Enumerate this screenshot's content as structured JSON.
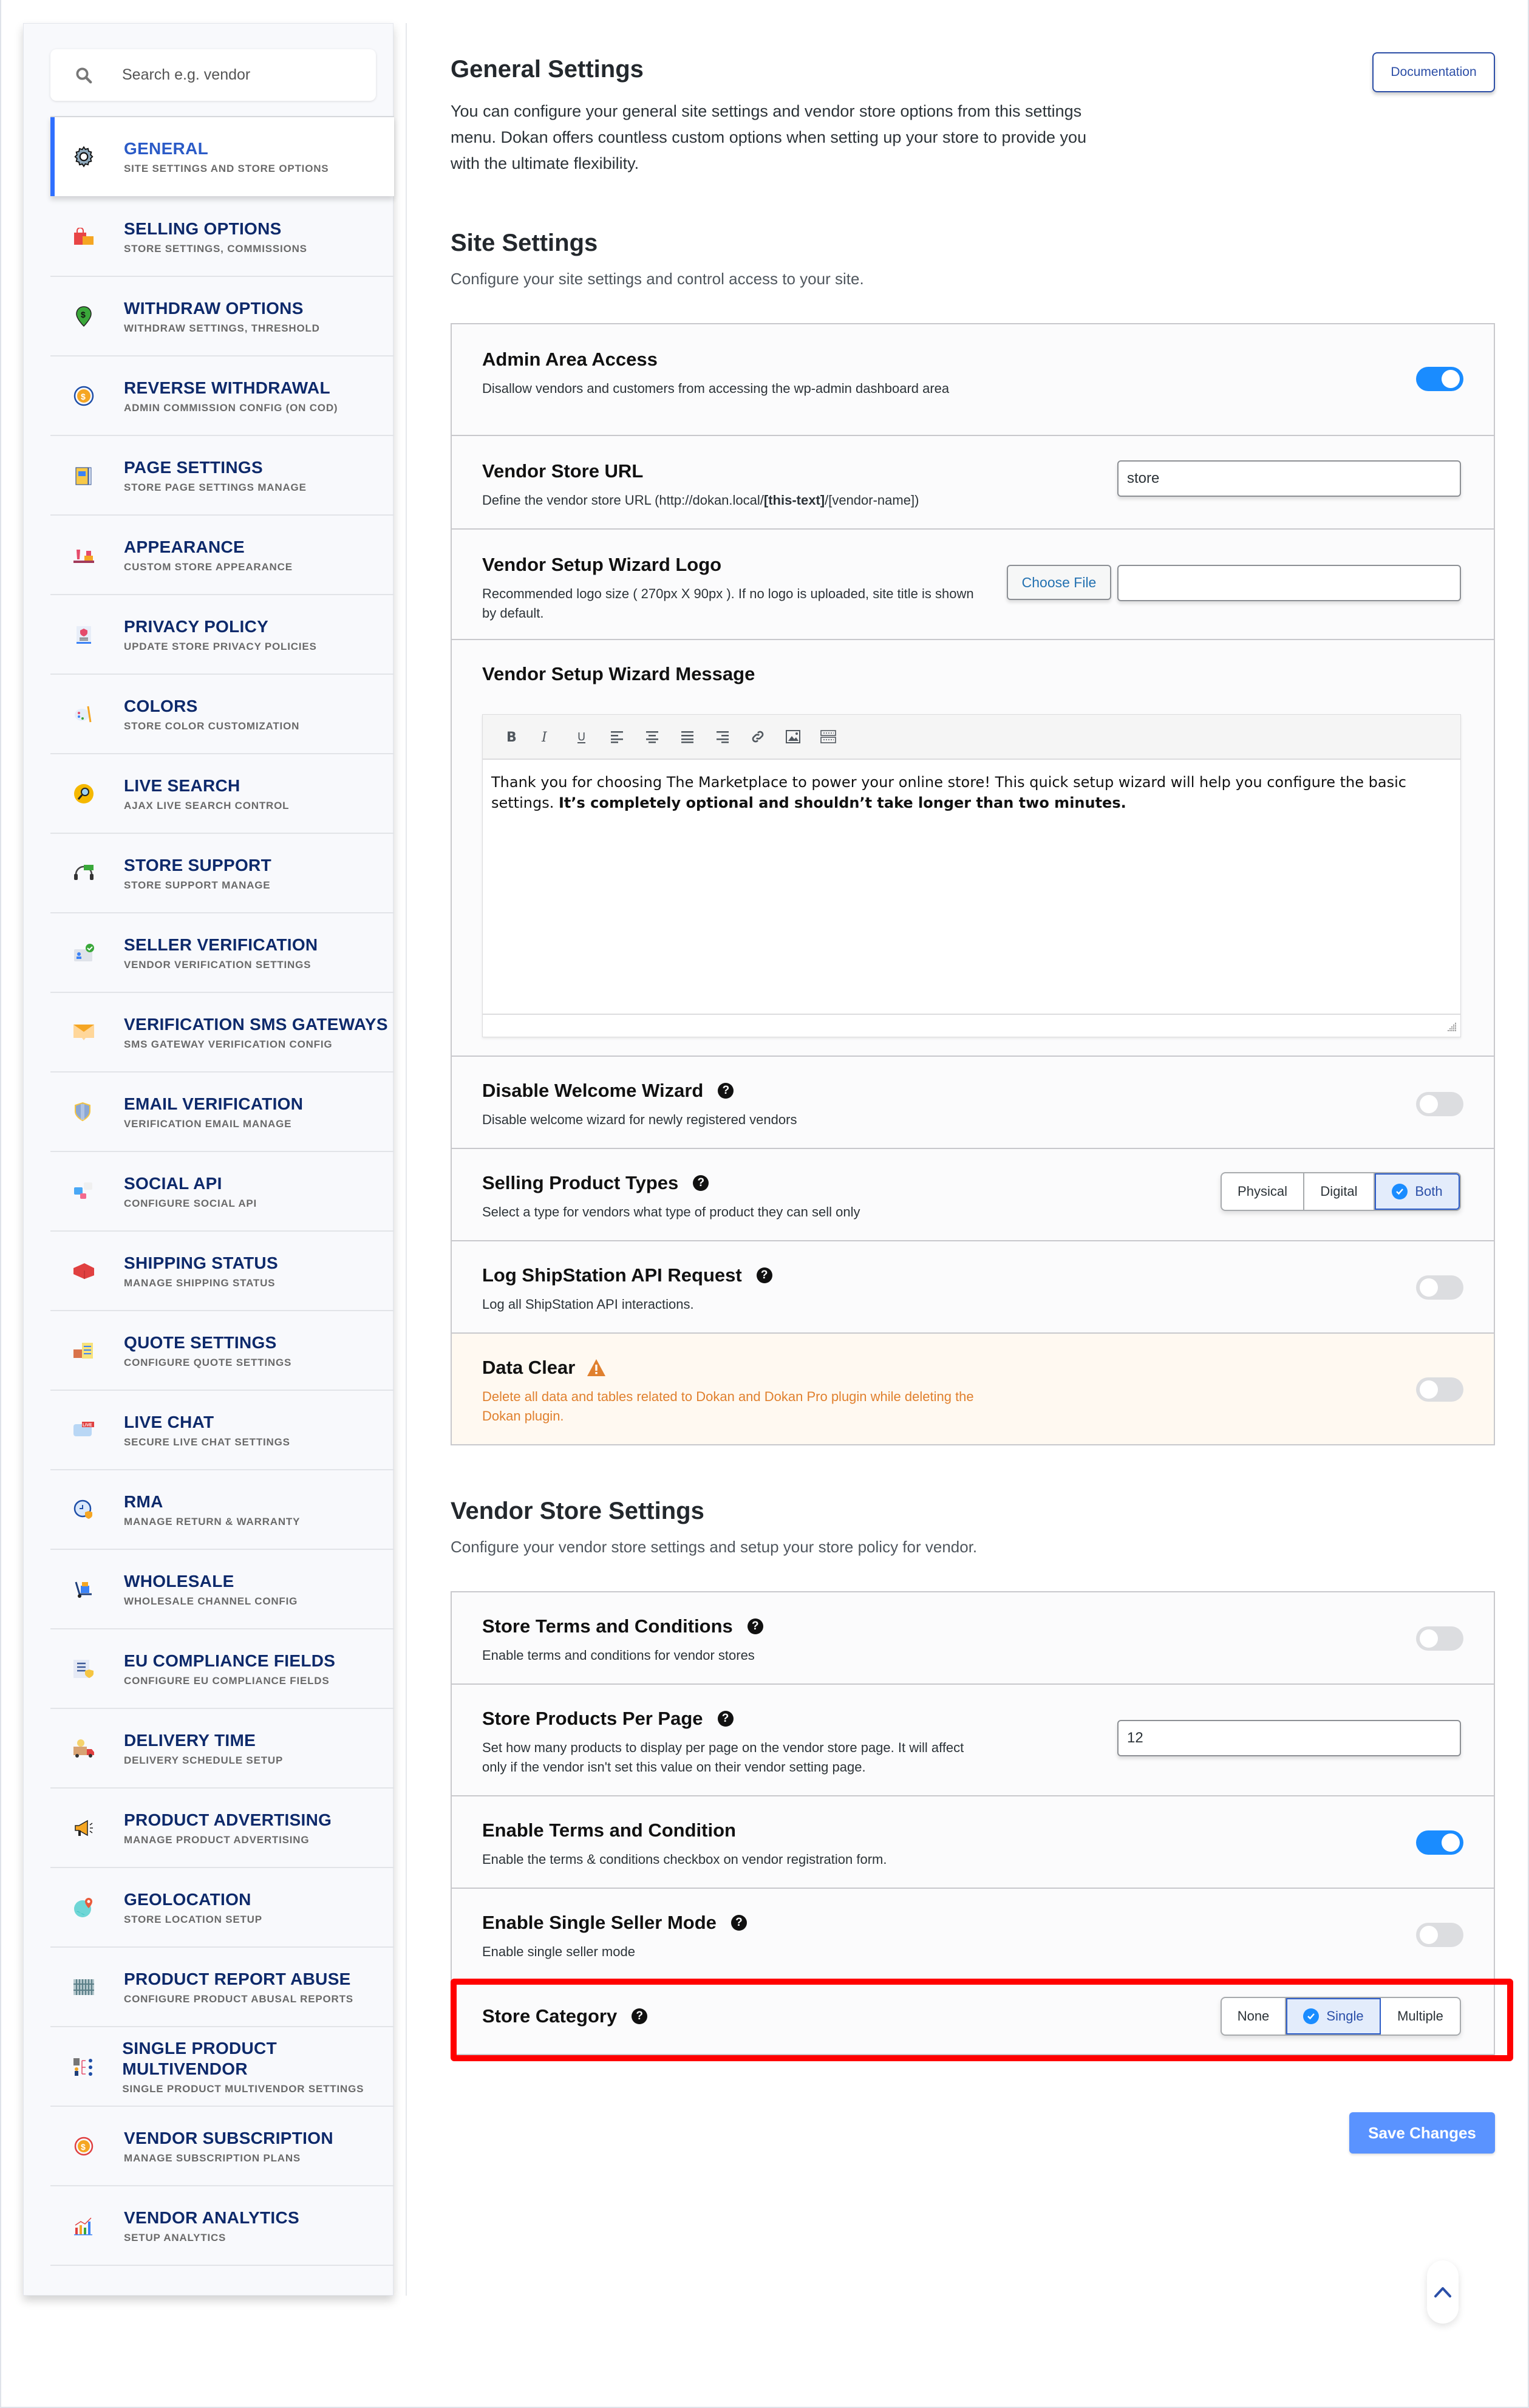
{
  "search": {
    "placeholder": "Search e.g. vendor"
  },
  "sidebar": {
    "items": [
      {
        "title": "GENERAL",
        "subtitle": "SITE SETTINGS AND STORE OPTIONS",
        "icon": "gear-icon",
        "active": true
      },
      {
        "title": "SELLING OPTIONS",
        "subtitle": "STORE SETTINGS, COMMISSIONS",
        "icon": "shopping-bag-icon"
      },
      {
        "title": "WITHDRAW OPTIONS",
        "subtitle": "WITHDRAW SETTINGS, THRESHOLD",
        "icon": "money-pin-icon"
      },
      {
        "title": "REVERSE WITHDRAWAL",
        "subtitle": "ADMIN COMMISSION CONFIG (ON COD)",
        "icon": "coin-cycle-icon"
      },
      {
        "title": "PAGE SETTINGS",
        "subtitle": "STORE PAGE SETTINGS MANAGE",
        "icon": "page-icon"
      },
      {
        "title": "APPEARANCE",
        "subtitle": "CUSTOM STORE APPEARANCE",
        "icon": "store-display-icon"
      },
      {
        "title": "PRIVACY POLICY",
        "subtitle": "UPDATE STORE PRIVACY POLICIES",
        "icon": "privacy-document-icon"
      },
      {
        "title": "COLORS",
        "subtitle": "STORE COLOR CUSTOMIZATION",
        "icon": "palette-icon"
      },
      {
        "title": "LIVE SEARCH",
        "subtitle": "AJAX LIVE SEARCH CONTROL",
        "icon": "magnifier-icon"
      },
      {
        "title": "STORE SUPPORT",
        "subtitle": "STORE SUPPORT MANAGE",
        "icon": "headset-icon"
      },
      {
        "title": "SELLER VERIFICATION",
        "subtitle": "VENDOR VERIFICATION SETTINGS",
        "icon": "id-card-check-icon"
      },
      {
        "title": "VERIFICATION SMS GATEWAYS",
        "subtitle": "SMS GATEWAY VERIFICATION CONFIG",
        "icon": "envelope-icon"
      },
      {
        "title": "EMAIL VERIFICATION",
        "subtitle": "VERIFICATION EMAIL MANAGE",
        "icon": "shield-check-icon"
      },
      {
        "title": "SOCIAL API",
        "subtitle": "CONFIGURE SOCIAL API",
        "icon": "social-bubbles-icon"
      },
      {
        "title": "SHIPPING STATUS",
        "subtitle": "MANAGE SHIPPING STATUS",
        "icon": "container-icon"
      },
      {
        "title": "QUOTE SETTINGS",
        "subtitle": "CONFIGURE QUOTE SETTINGS",
        "icon": "quote-checklist-icon"
      },
      {
        "title": "LIVE CHAT",
        "subtitle": "SECURE LIVE CHAT SETTINGS",
        "icon": "live-chat-icon"
      },
      {
        "title": "RMA",
        "subtitle": "MANAGE RETURN & WARRANTY",
        "icon": "warranty-clock-icon"
      },
      {
        "title": "WHOLESALE",
        "subtitle": "WHOLESALE CHANNEL CONFIG",
        "icon": "hand-truck-icon"
      },
      {
        "title": "EU COMPLIANCE FIELDS",
        "subtitle": "CONFIGURE EU COMPLIANCE FIELDS",
        "icon": "compliance-list-icon"
      },
      {
        "title": "DELIVERY TIME",
        "subtitle": "DELIVERY SCHEDULE SETUP",
        "icon": "delivery-truck-icon"
      },
      {
        "title": "PRODUCT ADVERTISING",
        "subtitle": "MANAGE PRODUCT ADVERTISING",
        "icon": "megaphone-icon"
      },
      {
        "title": "GEOLOCATION",
        "subtitle": "STORE LOCATION SETUP",
        "icon": "globe-pin-icon"
      },
      {
        "title": "PRODUCT REPORT ABUSE",
        "subtitle": "CONFIGURE PRODUCT ABUSAL REPORTS",
        "icon": "jail-icon"
      },
      {
        "title": "SINGLE PRODUCT MULTIVENDOR",
        "subtitle": "SINGLE PRODUCT MULTIVENDOR SETTINGS",
        "icon": "multivendor-icon"
      },
      {
        "title": "VENDOR SUBSCRIPTION",
        "subtitle": "MANAGE SUBSCRIPTION PLANS",
        "icon": "subscription-icon"
      },
      {
        "title": "VENDOR ANALYTICS",
        "subtitle": "SETUP ANALYTICS",
        "icon": "bar-chart-icon"
      }
    ]
  },
  "header": {
    "title": "General Settings",
    "description": "You can configure your general site settings and vendor store options from this settings menu. Dokan offers countless custom options when setting up your store to provide you with the ultimate flexibility.",
    "documentation_label": "Documentation"
  },
  "site_settings": {
    "title": "Site Settings",
    "description": "Configure your site settings and control access to your site.",
    "admin_area_access": {
      "title": "Admin Area Access",
      "description": "Disallow vendors and customers from accessing the wp-admin dashboard area",
      "enabled": true
    },
    "vendor_store_url": {
      "title": "Vendor Store URL",
      "description_prefix": "Define the vendor store URL (http://dokan.local/",
      "description_bold": "[this-text]",
      "description_suffix": "/[vendor-name])",
      "value": "store"
    },
    "wizard_logo": {
      "title": "Vendor Setup Wizard Logo",
      "description": "Recommended logo size ( 270px X 90px ). If no logo is uploaded, site title is shown by default.",
      "button_label": "Choose File",
      "value": ""
    },
    "wizard_message": {
      "title": "Vendor Setup Wizard Message",
      "toolbar": [
        "bold",
        "italic",
        "underline",
        "align-left",
        "align-center",
        "align-justify",
        "align-right",
        "link",
        "image",
        "table"
      ],
      "text_normal": "Thank you for choosing The Marketplace to power your online store! This quick setup wizard will help you configure the basic settings. ",
      "text_bold": "It’s completely optional and shouldn’t take longer than two minutes."
    },
    "disable_welcome_wizard": {
      "title": "Disable Welcome Wizard",
      "description": "Disable welcome wizard for newly registered vendors",
      "enabled": false
    },
    "selling_product_types": {
      "title": "Selling Product Types",
      "description": "Select a type for vendors what type of product they can sell only",
      "options": [
        "Physical",
        "Digital",
        "Both"
      ],
      "selected": "Both"
    },
    "log_shipstation": {
      "title": "Log ShipStation API Request",
      "description": "Log all ShipStation API interactions.",
      "enabled": false
    },
    "data_clear": {
      "title": "Data Clear",
      "description": "Delete all data and tables related to Dokan and Dokan Pro plugin while deleting the Dokan plugin.",
      "enabled": false,
      "warning_color": "#e0802e"
    }
  },
  "vendor_store_settings": {
    "title": "Vendor Store Settings",
    "description": "Configure your vendor store settings and setup your store policy for vendor.",
    "store_terms": {
      "title": "Store Terms and Conditions",
      "description": "Enable terms and conditions for vendor stores",
      "enabled": false
    },
    "products_per_page": {
      "title": "Store Products Per Page",
      "description": "Set how many products to display per page on the vendor store page. It will affect only if the vendor isn't set this value on their vendor setting page.",
      "value": "12"
    },
    "enable_terms": {
      "title": "Enable Terms and Condition",
      "description": "Enable the terms & conditions checkbox on vendor registration form.",
      "enabled": true
    },
    "single_seller_mode": {
      "title": "Enable Single Seller Mode",
      "description": "Enable single seller mode",
      "enabled": false
    },
    "store_category": {
      "title": "Store Category",
      "options": [
        "None",
        "Single",
        "Multiple"
      ],
      "selected": "Single"
    }
  },
  "footer": {
    "save_label": "Save Changes"
  },
  "colors": {
    "accent": "#1a8cff",
    "nav_title": "#0e2a6b",
    "active_bar": "#2f6fff",
    "save_button": "#5a93ff",
    "highlight": "#ff0000"
  }
}
